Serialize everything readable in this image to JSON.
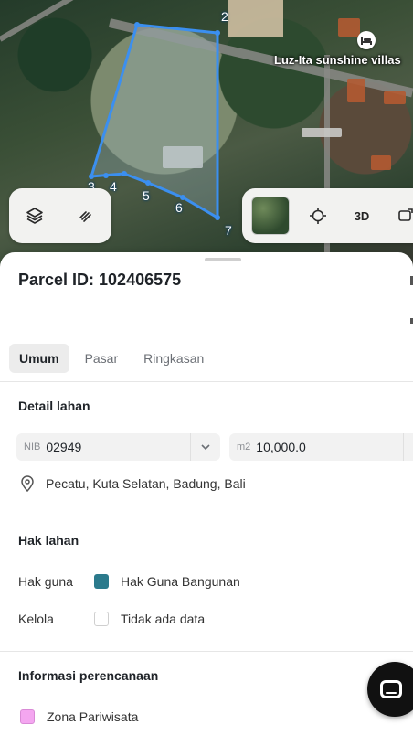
{
  "map": {
    "poi_label": "Luz-Ita sunshine villas",
    "poi_icon": "bed-icon",
    "vertex_labels": [
      "2",
      "3",
      "4",
      "5",
      "6",
      "7"
    ],
    "parcel_outline_color": "#3b8ff0",
    "controls_left": [
      "layers-icon",
      "measure-icon"
    ],
    "controls_right": {
      "basemap": "satellite-thumbnail",
      "locate_icon": "crosshair-icon",
      "three_d_label": "3D",
      "extra_icon": "share-icon"
    }
  },
  "sheet": {
    "title": "Parcel ID: 102406575",
    "tabs": [
      {
        "label": "Umum",
        "active": true
      },
      {
        "label": "Pasar",
        "active": false
      },
      {
        "label": "Ringkasan",
        "active": false
      }
    ],
    "detail": {
      "title": "Detail lahan",
      "nib_prefix": "NIB",
      "nib_value": "02949",
      "area_prefix": "m2",
      "area_value": "10,000.0",
      "address": "Pecatu, Kuta Selatan, Badung, Bali"
    },
    "rights": {
      "title": "Hak lahan",
      "rows": [
        {
          "label": "Hak guna",
          "value": "Hak Guna Bangunan",
          "color": "#2b7a8c"
        },
        {
          "label": "Kelola",
          "value": "Tidak ada data",
          "color": "#ffffff"
        }
      ]
    },
    "planning": {
      "title": "Informasi perencanaan",
      "zone_label": "Zona Pariwisata",
      "zone_color": "#f4a6f0"
    }
  }
}
